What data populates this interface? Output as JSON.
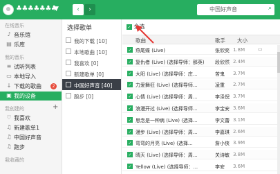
{
  "topbar": {
    "username": "♣♣♣♣♣♣♣",
    "search_placeholder": "中国好声音",
    "colors": {
      "accent": "#27ae60"
    }
  },
  "sidebar": {
    "online_title": "在线音乐",
    "online_items": [
      {
        "label": "音乐馆",
        "icon": "music-note-icon"
      },
      {
        "label": "乐库",
        "icon": "library-icon"
      }
    ],
    "my_title": "我的音乐",
    "my_items": [
      {
        "label": "试听列表",
        "icon": "list-icon"
      },
      {
        "label": "本地导入",
        "icon": "import-icon"
      },
      {
        "label": "下载的歌曲",
        "icon": "download-icon",
        "badge": "2"
      },
      {
        "label": "我的设备",
        "icon": "device-icon",
        "active": true
      }
    ],
    "created_title": "我创建的",
    "created_items": [
      {
        "label": "我喜欢",
        "icon": "heart-icon"
      },
      {
        "label": "新建歌单1",
        "icon": "playlist-icon"
      },
      {
        "label": "中国好声音",
        "icon": "playlist-icon"
      },
      {
        "label": "跑步",
        "icon": "playlist-icon"
      }
    ],
    "bottom_title": "我收藏的"
  },
  "middle": {
    "title": "选择歌单",
    "items": [
      {
        "label": "我的下载 [10]"
      },
      {
        "label": "本地歌曲 [10]"
      },
      {
        "label": "我喜欢 [0]"
      },
      {
        "label": "新建歌单 [0]"
      },
      {
        "label": "中国好声音 [40]",
        "active": true
      },
      {
        "label": "跑步 [0]"
      }
    ]
  },
  "content": {
    "select_all": "全选",
    "headers": {
      "song": "歌曲",
      "singer": "歌手",
      "size": "大小"
    },
    "rows": [
      {
        "song": "燕尾蝶 (Live)",
        "singer": "张欣奕",
        "size": "1.8M"
      },
      {
        "song": "复仇者 (Live) (选择导师：那英)",
        "singer": "段欣然",
        "size": "2.4M"
      },
      {
        "song": "大阳 (Live) (选择导师：庄...",
        "singer": "苦鬼",
        "size": "3.7M"
      },
      {
        "song": "力爱舞狂 (Live) (选择导师...",
        "singer": "凌重",
        "size": "2.7M"
      },
      {
        "song": "心情 (Live) (选择导师：周...",
        "singer": "李泽倪",
        "size": "3.7M"
      },
      {
        "song": "浪漫开过 (Live) (选择导师...",
        "singer": "李宝安",
        "size": "3.6M"
      },
      {
        "song": "思念是一种病 (Live) (选择...",
        "singer": "李文蕾",
        "size": "3.1M"
      },
      {
        "song": "漫步 (Live) (选择导师：周...",
        "singer": "李嘉琪",
        "size": "2.6M"
      },
      {
        "song": "弯弯的月亮 (Live) (选择...",
        "singer": "詹小侠",
        "size": "3.9M"
      },
      {
        "song": "晴天 (Live) (选择导师：周...",
        "singer": "关诗敏",
        "size": "3.8M"
      },
      {
        "song": "Yellow (Live) (选择导师：...",
        "singer": "李安",
        "size": "3.6M"
      }
    ]
  }
}
